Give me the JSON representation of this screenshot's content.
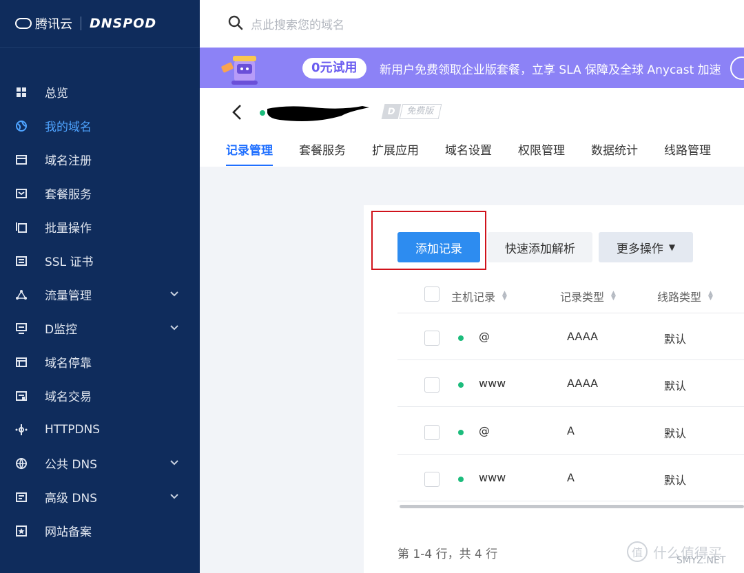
{
  "brand": {
    "name_cn": "腾讯云",
    "name_en": "DNSPOD"
  },
  "search": {
    "placeholder": "点此搜索您的域名"
  },
  "sidebar": {
    "items": [
      {
        "label": "总览",
        "icon": "dashboard-icon",
        "active": false,
        "expandable": false
      },
      {
        "label": "我的域名",
        "icon": "globe-icon",
        "active": true,
        "expandable": false
      },
      {
        "label": "域名注册",
        "icon": "register-icon",
        "active": false,
        "expandable": false
      },
      {
        "label": "套餐服务",
        "icon": "package-icon",
        "active": false,
        "expandable": false
      },
      {
        "label": "批量操作",
        "icon": "batch-icon",
        "active": false,
        "expandable": false
      },
      {
        "label": "SSL 证书",
        "icon": "certificate-icon",
        "active": false,
        "expandable": false
      },
      {
        "label": "流量管理",
        "icon": "traffic-icon",
        "active": false,
        "expandable": true
      },
      {
        "label": "D监控",
        "icon": "monitor-icon",
        "active": false,
        "expandable": true
      },
      {
        "label": "域名停靠",
        "icon": "parking-icon",
        "active": false,
        "expandable": false
      },
      {
        "label": "域名交易",
        "icon": "trade-icon",
        "active": false,
        "expandable": false
      },
      {
        "label": "HTTPDNS",
        "icon": "httpdns-icon",
        "active": false,
        "expandable": false
      },
      {
        "label": "公共 DNS",
        "icon": "public-dns-icon",
        "active": false,
        "expandable": true
      },
      {
        "label": "高级 DNS",
        "icon": "advanced-dns-icon",
        "active": false,
        "expandable": true
      },
      {
        "label": "网站备案",
        "icon": "filing-icon",
        "active": false,
        "expandable": false
      }
    ]
  },
  "banner": {
    "badge": "0元试用",
    "text": "新用户免费领取企业版套餐，立享 SLA 保障及全球 Anycast 加速"
  },
  "domain": {
    "plan_badge": "免费版",
    "plan_letter": "D"
  },
  "tabs": [
    "记录管理",
    "套餐服务",
    "扩展应用",
    "域名设置",
    "权限管理",
    "数据统计",
    "线路管理"
  ],
  "toolbar": {
    "add_label": "添加记录",
    "quick_label": "快速添加解析",
    "more_label": "更多操作"
  },
  "table": {
    "headers": [
      "主机记录",
      "记录类型",
      "线路类型"
    ],
    "rows": [
      {
        "host": "@",
        "type": "AAAA",
        "line": "默认"
      },
      {
        "host": "www",
        "type": "AAAA",
        "line": "默认"
      },
      {
        "host": "@",
        "type": "A",
        "line": "默认"
      },
      {
        "host": "www",
        "type": "A",
        "line": "默认"
      }
    ]
  },
  "pager": {
    "text": "第 1-4 行，共 4 行"
  },
  "watermark": {
    "icon_char": "值",
    "text": "什么值得买",
    "site": "SMYZ.NET"
  },
  "colors": {
    "sidebar_bg": "#0f2c5c",
    "accent": "#2d8cf0",
    "banner_bg": "#8c82f6",
    "active_nav": "#4ea3ff",
    "status_dot": "#1cbc7c",
    "highlight_box": "#d0121b"
  }
}
